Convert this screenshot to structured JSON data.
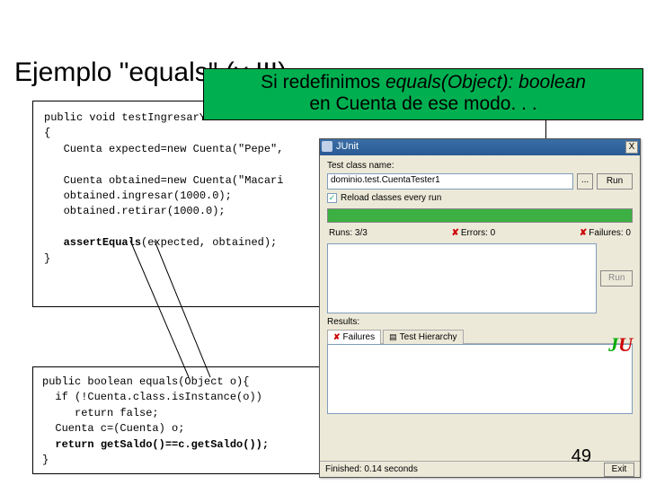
{
  "title": "Ejemplo \"equals\" (y III)",
  "callout": {
    "line1a": "Si redefinimos ",
    "line1b": "equals(Object): boolean",
    "line2": "en Cuenta de ese modo. . ."
  },
  "code1": {
    "l1": "public void testIngresarYReti",
    "l2": "{",
    "l3": "   Cuenta expected=new Cuenta(\"Pepe\",",
    "l4": "",
    "l5": "   Cuenta obtained=new Cuenta(\"Macari",
    "l6": "   obtained.ingresar(1000.0);",
    "l7": "   obtained.retirar(1000.0);",
    "l8": "",
    "l9a_plain": "   ",
    "l9a_bold": "assertEquals",
    "l9b_plain": "(expected, obtained);",
    "l10": "}"
  },
  "code2": {
    "l1": "public boolean equals(Object o){",
    "l2": "  if (!Cuenta.class.isInstance(o))",
    "l3": "     return false;",
    "l4": "  Cuenta c=(Cuenta) o;",
    "l5a": "  ",
    "l5b": "return getSaldo()==c.getSaldo());",
    "l6": "}"
  },
  "junit": {
    "wintitle": "JUnit",
    "close": "X",
    "testclass_label": "Test class name:",
    "testclass_value": "dominio.test.CuentaTester1",
    "dots": "...",
    "run_btn": "Run",
    "reload_check": "✓",
    "reload_label": "Reload classes every run",
    "logo_j": "J",
    "logo_u": "U",
    "runs_label": "Runs:",
    "runs_value": "3/3",
    "errors_label": "Errors:",
    "errors_value": "0",
    "failures_label": "Failures:",
    "failures_value": "0",
    "results_label": "Results:",
    "tab_failures": "Failures",
    "tab_hierarchy": "Test Hierarchy",
    "status_left": "Finished: 0.14 seconds",
    "status_right": "Exit"
  },
  "slide_number": "49"
}
